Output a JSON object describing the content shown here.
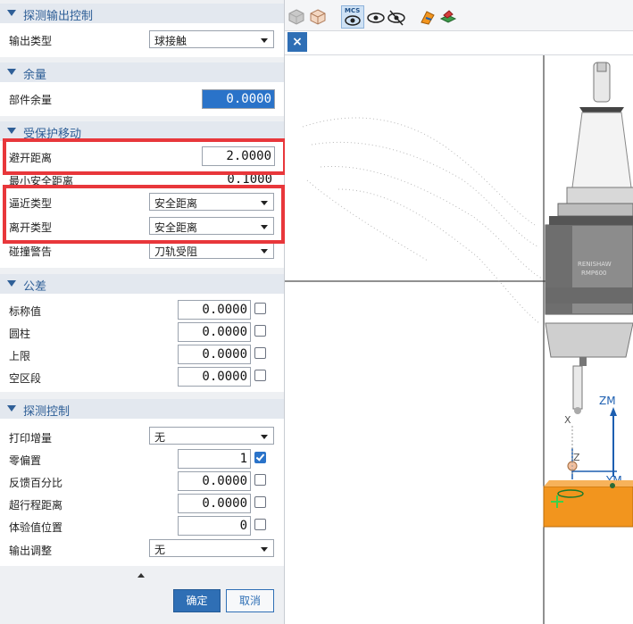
{
  "dialog": {
    "sections": {
      "probe_output": {
        "title": "探测输出控制",
        "output_type_label": "输出类型",
        "output_type_value": "球接触"
      },
      "stock": {
        "title": "余量",
        "part_stock_label": "部件余量",
        "part_stock_value": "0.0000"
      },
      "protected_move": {
        "title": "受保护移动",
        "clearance_label": "避开距离",
        "clearance_value": "2.0000",
        "min_safe_label": "最小安全距离",
        "min_safe_value": "0.1000",
        "approach_label": "逼近类型",
        "approach_value": "安全距离",
        "depart_label": "离开类型",
        "depart_value": "安全距离",
        "collision_label": "碰撞警告",
        "collision_value": "刀轨受阻"
      },
      "tolerance": {
        "title": "公差",
        "rows": [
          {
            "label": "标称值",
            "value": "0.0000"
          },
          {
            "label": "圆柱",
            "value": "0.0000"
          },
          {
            "label": "上限",
            "value": "0.0000"
          },
          {
            "label": "空区段",
            "value": "0.0000"
          }
        ]
      },
      "probe_control": {
        "title": "探测控制",
        "print_incr_label": "打印增量",
        "print_incr_value": "无",
        "zero_offset_label": "零偏置",
        "zero_offset_value": "1",
        "feedback_label": "反馈百分比",
        "feedback_value": "0.0000",
        "overtravel_label": "超行程距离",
        "overtravel_value": "0.0000",
        "experience_label": "体验值位置",
        "experience_value": "0",
        "output_adjust_label": "输出调整",
        "output_adjust_value": "无"
      }
    },
    "buttons": {
      "ok": "确定",
      "cancel": "取消"
    }
  },
  "toolbar": {
    "icons": [
      "cube-shaded-icon",
      "cube-wire-icon",
      "mcs-display-icon",
      "eye-show-icon",
      "eye-hide-icon",
      "tool-path-icon",
      "layer-icon"
    ],
    "mcs_label": "MCS"
  },
  "viewport": {
    "probe_labels": [
      "RENISHAW",
      "RMP600"
    ],
    "axis_labels": {
      "zm": "ZM",
      "ym": "YM",
      "x": "X",
      "z": "Z"
    }
  },
  "colors": {
    "accent": "#2f6fb5",
    "highlight": "#e8373b",
    "workpiece": "#f2951e",
    "section_title": "#2f5f97"
  }
}
